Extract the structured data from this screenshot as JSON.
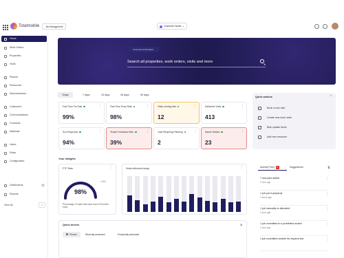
{
  "topbar": {
    "brand": "Totalmobile",
    "breadcrumb": "Job Management",
    "customer_select": "Customer Name"
  },
  "sidebar": {
    "items": [
      {
        "label": "Home",
        "active": true
      },
      {
        "label": "Work Orders"
      },
      {
        "label": "Properties"
      },
      {
        "label": "Visits"
      },
      {
        "label": "Planner"
      },
      {
        "label": "Resources"
      },
      {
        "label": "Subcontractors"
      },
      {
        "label": "Customers"
      },
      {
        "label": "Communications"
      },
      {
        "label": "Contracts"
      },
      {
        "label": "Materials"
      },
      {
        "label": "Users"
      },
      {
        "label": "Roles"
      },
      {
        "label": "Configuration"
      },
      {
        "label": "Dashboards",
        "badge": "3"
      },
      {
        "label": "Reports"
      }
    ],
    "view_all": "View all",
    "colors": {
      "active_bg": "#1f1d5e"
    }
  },
  "hero": {
    "powered": "Powered by MondelAI",
    "search_placeholder": "Search all properties, work orders, visits and more",
    "bg": "#1f1a4f"
  },
  "period_tabs": [
    "Today",
    "7 days",
    "15 days",
    "28 days",
    "90 days"
  ],
  "kpis": [
    {
      "title": "First Time Fix Rate",
      "value": "99%",
      "dot": true,
      "status": "normal"
    },
    {
      "title": "First Time Entry Rate",
      "value": "98%",
      "dot": true,
      "status": "normal"
    },
    {
      "title": "Visits running late",
      "value": "12",
      "dot": true,
      "status": "warning"
    },
    {
      "title": "Delivered Visits",
      "value": "413",
      "dot": true,
      "status": "normal"
    },
    {
      "title": "SLA Response",
      "value": "94%",
      "dot": true,
      "status": "normal"
    },
    {
      "title": "Tenant Feedback Rate",
      "value": "39%",
      "dot": true,
      "status": "alert"
    },
    {
      "title": "Jobs Requiring Planning",
      "value": "2",
      "dot": true,
      "status": "normal"
    },
    {
      "title": "Issues Raised",
      "value": "23",
      "dot": true,
      "status": "alert"
    }
  ],
  "quick_actions": {
    "title": "Quick actions",
    "items": [
      "Book a new visit",
      "Create new work order",
      "Bulk update items",
      "Add new resource"
    ]
  },
  "widgets_title": "Your widgets",
  "ftfr_widget": {
    "title": "FTF Rate",
    "value": "98%",
    "delta": "↗ 10%",
    "fill": 0.98,
    "description": "Percentage of visits that have had a First time entry"
  },
  "visits_widget": {
    "title": "Visits delivered today",
    "bars": [
      0.47,
      0.33,
      0.22,
      0.29,
      0.43,
      0.27,
      0.36,
      0.28,
      0.5,
      0.41,
      0.3,
      0.26,
      0.36,
      0.27,
      0.29
    ]
  },
  "activity": {
    "tab_label": "Activity Feed",
    "badge": "3",
    "other_tab": "Suggestions",
    "items": [
      {
        "title": "7 new jobs added",
        "time": "1 hour ago"
      },
      {
        "title": "1 job put in jeopardy",
        "time": "2 hours ago"
      },
      {
        "title": "1 job manually re-allocated",
        "time": "1 hour ago"
      },
      {
        "title": "1 job committed to a prohibited worker",
        "time": "1 hour ago"
      },
      {
        "title": "1 job committed outside its required slot",
        "time": ""
      }
    ]
  },
  "quick_access": {
    "title": "Quick access",
    "tabs": [
      "Pinned",
      "Recently accessed",
      "Frequently accessed"
    ]
  }
}
